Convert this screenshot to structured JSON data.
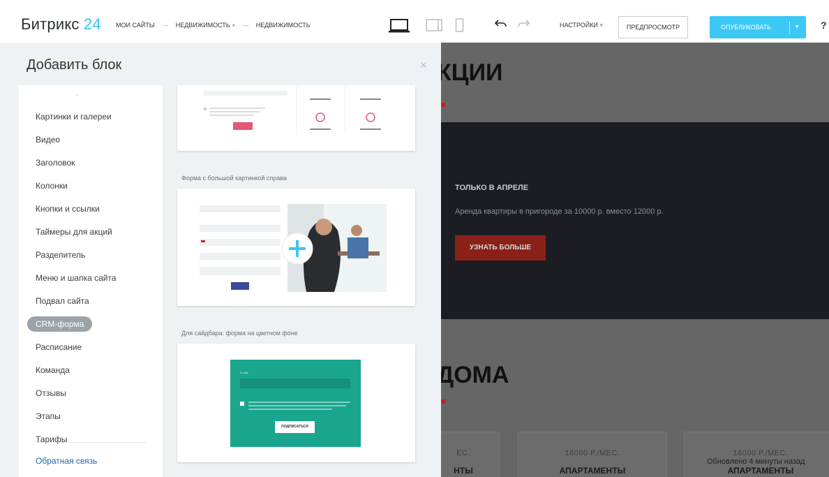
{
  "app": {
    "logo_text": "Битрикс",
    "logo_num": "24"
  },
  "breadcrumb": [
    "МОИ САЙТЫ",
    "НЕДВИЖИМОСТЬ",
    "НЕДВИЖИМОСТЬ"
  ],
  "toolbar": {
    "settings": "НАСТРОЙКИ",
    "preview": "ПРЕДПРОСМОТР",
    "publish": "ОПУБЛИКОВАТЬ",
    "help": "?"
  },
  "panel": {
    "title": "Добавить блок",
    "menu": [
      "Картинки и галереи",
      "Видео",
      "Заголовок",
      "Колонки",
      "Кнопки и ссылки",
      "Таймеры для акций",
      "Разделитель",
      "Меню и шапка сайта",
      "Подвал сайта",
      "CRM-форма",
      "Расписание",
      "Команда",
      "Отзывы",
      "Этапы",
      "Тарифы"
    ],
    "active": "CRM-форма",
    "feedback": "Обратная связь",
    "blocks": [
      {
        "label": "Форма с большой картинкой справа"
      },
      {
        "label": "Для сайдбара: форма на цветном фоне"
      }
    ],
    "mini": {
      "submit": "ПОДПИСАТЬСЯ",
      "email": "E-mail"
    }
  },
  "site": {
    "heading1": "КЦИИ",
    "promo_tag": "ТОЛЬКО В АПРЕЛЕ",
    "promo_desc": "Аренда квартиры в пригороде за 10000 р. вместо 12000 р.",
    "promo_btn": "УЗНАТЬ БОЛЬШЕ",
    "heading2": "ДОМА",
    "cards": [
      {
        "price": "ЕС.",
        "title": "НТЫ"
      },
      {
        "price": "18000 Р./МЕС.",
        "title": "АПАРТАМЕНТЫ"
      },
      {
        "price": "18000 Р./МЕС.",
        "title": "АПАРТАМЕНТЫ"
      }
    ]
  },
  "status": {
    "updated": "Обновлено 4 минуты назад"
  },
  "colors": {
    "accent": "#3bc8f5",
    "brand_red": "#b02a22",
    "teal": "#1aa58f"
  }
}
